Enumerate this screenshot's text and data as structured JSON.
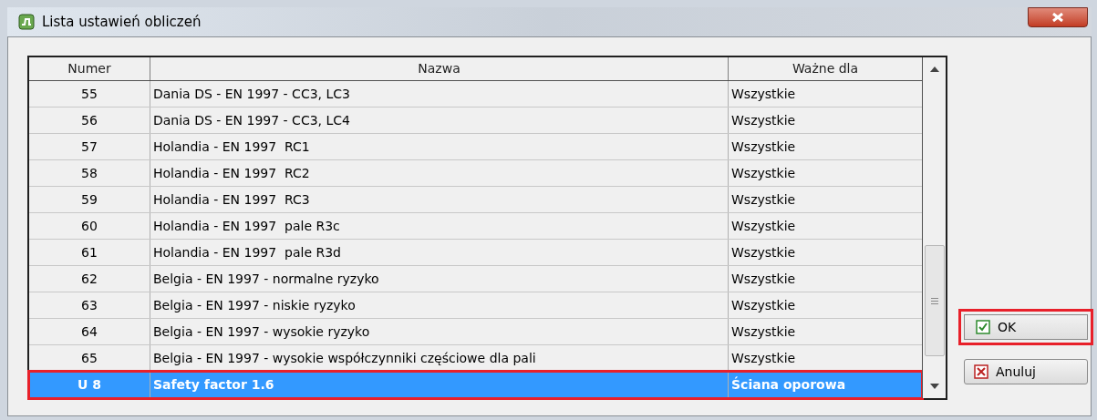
{
  "window": {
    "title": "Lista ustawień obliczeń"
  },
  "table": {
    "columns": [
      "Numer",
      "Nazwa",
      "Ważne dla"
    ],
    "rows": [
      {
        "number": "55",
        "name": "Dania DS - EN 1997 - CC3, LC3",
        "valid_for": "Wszystkie",
        "selected": false,
        "highlighted": false
      },
      {
        "number": "56",
        "name": "Dania DS - EN 1997 - CC3, LC4",
        "valid_for": "Wszystkie",
        "selected": false,
        "highlighted": false
      },
      {
        "number": "57",
        "name": "Holandia - EN 1997  RC1",
        "valid_for": "Wszystkie",
        "selected": false,
        "highlighted": false
      },
      {
        "number": "58",
        "name": "Holandia - EN 1997  RC2",
        "valid_for": "Wszystkie",
        "selected": false,
        "highlighted": false
      },
      {
        "number": "59",
        "name": "Holandia - EN 1997  RC3",
        "valid_for": "Wszystkie",
        "selected": false,
        "highlighted": false
      },
      {
        "number": "60",
        "name": "Holandia - EN 1997  pale R3c",
        "valid_for": "Wszystkie",
        "selected": false,
        "highlighted": false
      },
      {
        "number": "61",
        "name": "Holandia - EN 1997  pale R3d",
        "valid_for": "Wszystkie",
        "selected": false,
        "highlighted": false
      },
      {
        "number": "62",
        "name": "Belgia - EN 1997 - normalne ryzyko",
        "valid_for": "Wszystkie",
        "selected": false,
        "highlighted": false
      },
      {
        "number": "63",
        "name": "Belgia - EN 1997 - niskie ryzyko",
        "valid_for": "Wszystkie",
        "selected": false,
        "highlighted": false
      },
      {
        "number": "64",
        "name": "Belgia - EN 1997 - wysokie ryzyko",
        "valid_for": "Wszystkie",
        "selected": false,
        "highlighted": false
      },
      {
        "number": "65",
        "name": "Belgia - EN 1997 - wysokie współczynniki częściowe dla pali",
        "valid_for": "Wszystkie",
        "selected": false,
        "highlighted": false
      },
      {
        "number": "U 8",
        "name": "Safety factor 1.6",
        "valid_for": "Ściana oporowa",
        "selected": true,
        "highlighted": true
      }
    ]
  },
  "buttons": [
    {
      "kind": "ok",
      "label": "OK",
      "highlighted": true
    },
    {
      "kind": "cancel",
      "label": "Anuluj",
      "highlighted": false
    }
  ]
}
